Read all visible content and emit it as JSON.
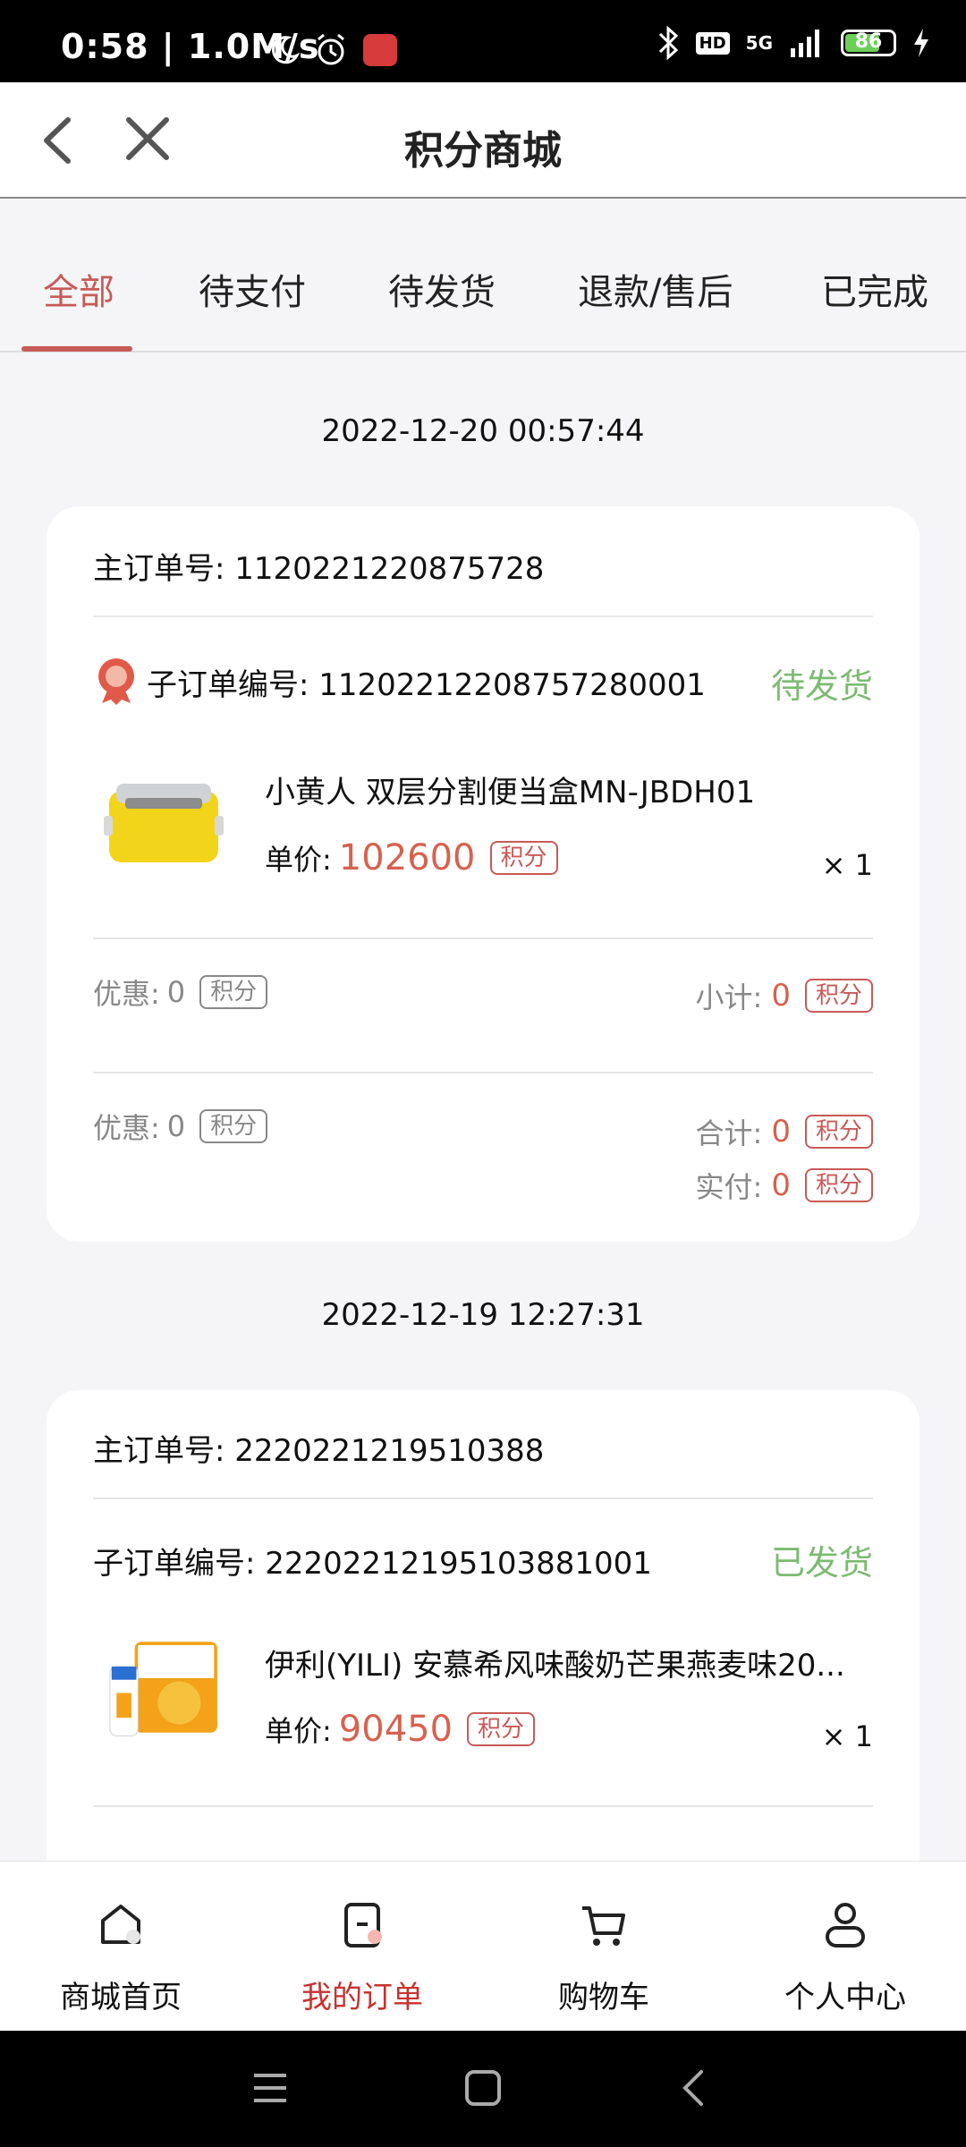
{
  "status_bar": {
    "time": "0:58",
    "speed": "1.0M/s",
    "battery_level": "86",
    "network": "5G",
    "hd": "HD"
  },
  "header": {
    "title": "积分商城"
  },
  "tabs": [
    {
      "label": "全部",
      "active": true
    },
    {
      "label": "待支付",
      "active": false
    },
    {
      "label": "待发货",
      "active": false
    },
    {
      "label": "退款/售后",
      "active": false
    },
    {
      "label": "已完成",
      "active": false
    }
  ],
  "orders": [
    {
      "date": "2022-12-20 00:57:44",
      "main_order_label": "主订单号: 1120221220875728",
      "sub_order_label": "子订单编号: 11202212208757280001",
      "status": "待发货",
      "product_name": "小黄人 双层分割便当盒MN-JBDH01",
      "unit_price_label": "单价:",
      "unit_price": "102600",
      "unit": "积分",
      "quantity": "× 1",
      "discount_label": "优惠:",
      "discount_value": "0",
      "subtotal_label": "小计:",
      "subtotal_value": "0",
      "discount2_label": "优惠:",
      "discount2_value": "0",
      "total_label": "合计:",
      "total_value": "0",
      "paid_label": "实付:",
      "paid_value": "0"
    },
    {
      "date": "2022-12-19 12:27:31",
      "main_order_label": "主订单号: 2220221219510388",
      "sub_order_label": "子订单编号: 22202212195103881001",
      "status": "已发货",
      "product_name": "伊利(YILI) 安慕希风味酸奶芒果燕麦味20...",
      "unit_price_label": "单价:",
      "unit_price": "90450",
      "unit": "积分",
      "quantity": "× 1"
    }
  ],
  "bottom_nav": [
    {
      "label": "商城首页",
      "active": false
    },
    {
      "label": "我的订单",
      "active": true
    },
    {
      "label": "购物车",
      "active": false
    },
    {
      "label": "个人中心",
      "active": false
    }
  ],
  "colors": {
    "accent": "#c85a57",
    "status_green": "#7cbb72",
    "price_red": "#d6624f"
  }
}
